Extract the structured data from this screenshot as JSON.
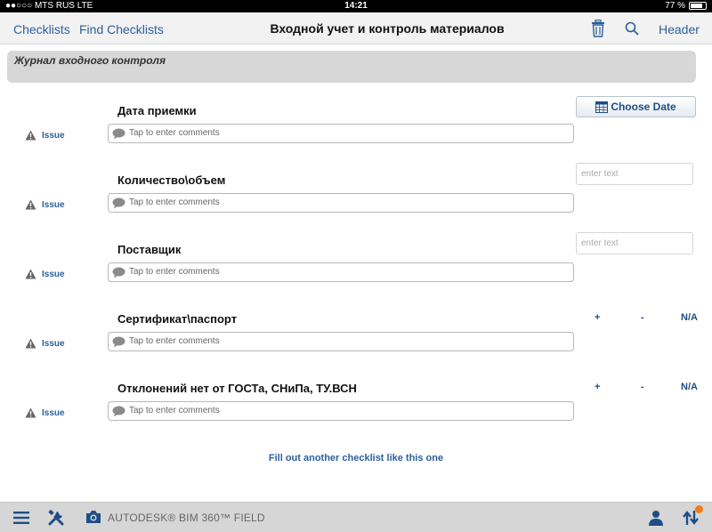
{
  "status": {
    "carrier": "●●○○○ MTS RUS   LTE",
    "time": "14:21",
    "battery": "77 %"
  },
  "nav": {
    "checklists": "Checklists",
    "find_checklists": "Find Checklists",
    "title": "Входной учет и контроль материалов",
    "header": "Header",
    "trash_icon": "trash-icon",
    "search_icon": "search-icon"
  },
  "section": {
    "title": "Журнал входного контроля"
  },
  "items": [
    {
      "title": "Дата приемки",
      "issue": "Issue",
      "comment_placeholder": "Tap to enter comments",
      "control": "date",
      "date_label": "Choose Date"
    },
    {
      "title": "Количество\\объем",
      "issue": "Issue",
      "comment_placeholder": "Tap to enter comments",
      "control": "text",
      "text_placeholder": "enter text"
    },
    {
      "title": "Поставщик",
      "issue": "Issue",
      "comment_placeholder": "Tap to enter comments",
      "control": "text",
      "text_placeholder": "enter text"
    },
    {
      "title": "Сертификат\\паспорт",
      "issue": "Issue",
      "comment_placeholder": "Tap to enter comments",
      "control": "options",
      "options": [
        "+",
        "-",
        "N/A"
      ]
    },
    {
      "title": "Отклонений нет от ГОСТа, СНиПа, ТУ.ВСН",
      "issue": "Issue",
      "comment_placeholder": "Tap to enter comments",
      "control": "options",
      "options": [
        "+",
        "-",
        "N/A"
      ]
    }
  ],
  "fill_another": "Fill out another checklist like this one",
  "bottom": {
    "brand": "AUTODESK® BIM 360™ FIELD",
    "accent": "#f07d1e"
  }
}
